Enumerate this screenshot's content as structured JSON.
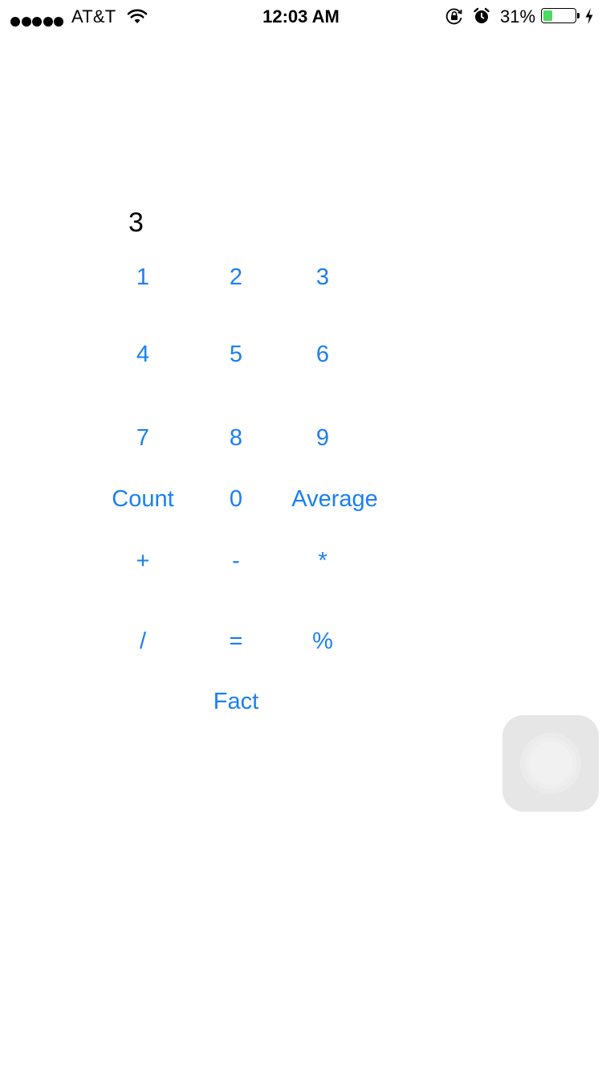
{
  "status_bar": {
    "carrier": "AT&T",
    "time": "12:03 AM",
    "battery_percent": "31%",
    "battery_level": 0.31,
    "signal_bars": 5,
    "icons": [
      "signal-dots-icon",
      "wifi-icon",
      "rotation-lock-icon",
      "alarm-icon",
      "battery-icon",
      "charging-bolt-icon"
    ],
    "battery_color": "#4cd964"
  },
  "display": {
    "value": "3"
  },
  "keypad": {
    "accent_color": "#1a7ff3",
    "keys": {
      "k1": "1",
      "k2": "2",
      "k3": "3",
      "k4": "4",
      "k5": "5",
      "k6": "6",
      "k7": "7",
      "k8": "8",
      "k9": "9",
      "count": "Count",
      "k0": "0",
      "average": "Average",
      "plus": "+",
      "minus": "-",
      "multiply": "*",
      "divide": "/",
      "equals": "=",
      "percent": "%",
      "fact": "Fact"
    }
  },
  "assistive_touch": {
    "icon": "assistive-touch-icon"
  }
}
